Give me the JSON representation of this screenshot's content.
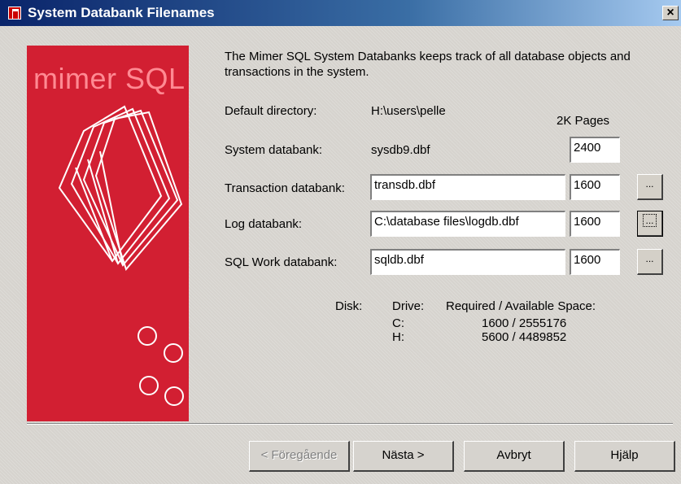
{
  "window": {
    "title": "System Databank Filenames",
    "close_label": "×"
  },
  "banner": {
    "logo_text": "mimer SQL",
    "colors": {
      "background": "#d21f32",
      "line": "#ffffff"
    }
  },
  "intro": {
    "text": "The Mimer SQL System Databanks keeps track of all database objects and transactions in the system."
  },
  "default_directory": {
    "label": "Default directory:",
    "value": "H:\\users\\pelle"
  },
  "pages_header": "2K Pages",
  "databanks": [
    {
      "label": "System databank:",
      "filename": "sysdb9.dbf",
      "pages": "2400",
      "browse": ""
    },
    {
      "label": "Transaction databank:",
      "filename": "transdb.dbf",
      "pages": "1600",
      "browse": "..."
    },
    {
      "label": "Log databank:",
      "filename": "C:\\database files\\logdb.dbf",
      "pages": "1600",
      "browse": "..."
    },
    {
      "label": "SQL Work databank:",
      "filename": "sqldb.dbf",
      "pages": "1600",
      "browse": "..."
    }
  ],
  "disk": {
    "label": "Disk:",
    "drive_header": "Drive:",
    "space_header": "Required / Available Space:",
    "rows": [
      {
        "drive": "C:",
        "space": "1600 / 2555176"
      },
      {
        "drive": "H:",
        "space": "5600 / 4489852"
      }
    ]
  },
  "buttons": {
    "back": "< Föregående",
    "next": "Nästa >",
    "cancel": "Avbryt",
    "help": "Hjälp"
  }
}
